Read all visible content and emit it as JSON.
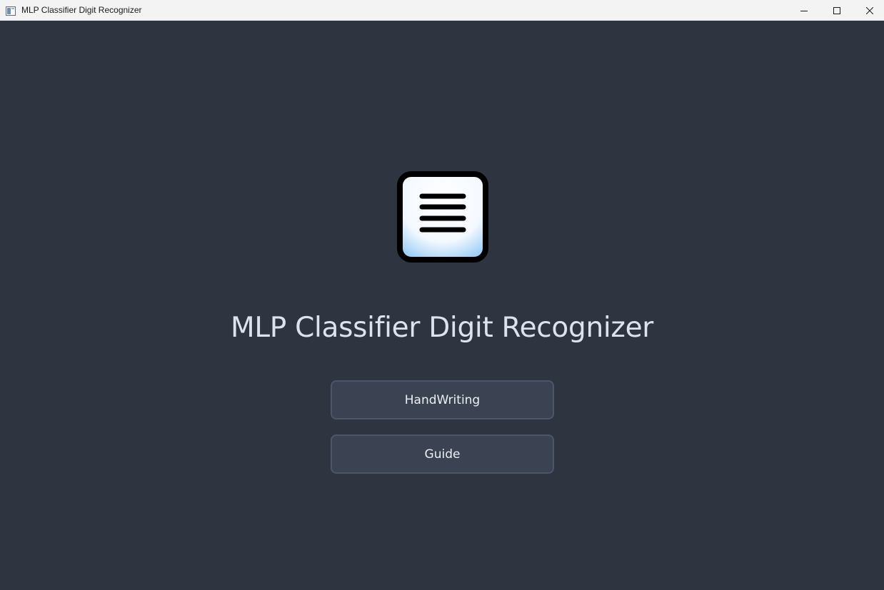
{
  "window": {
    "title": "MLP Classifier Digit Recognizer",
    "app_icon": "window-app-icon",
    "controls": {
      "minimize": "minimize-icon",
      "maximize": "maximize-icon",
      "close": "close-icon"
    }
  },
  "main": {
    "logo_icon": "document-lines-icon",
    "title": "MLP Classifier Digit Recognizer",
    "buttons": {
      "handwriting_label": "HandWriting",
      "guide_label": "Guide"
    }
  },
  "colors": {
    "background": "#2e3440",
    "button_bg": "#3b4252",
    "button_border": "#4c566a",
    "title_text": "#dde3ee",
    "titlebar_bg": "#f3f3f3"
  }
}
